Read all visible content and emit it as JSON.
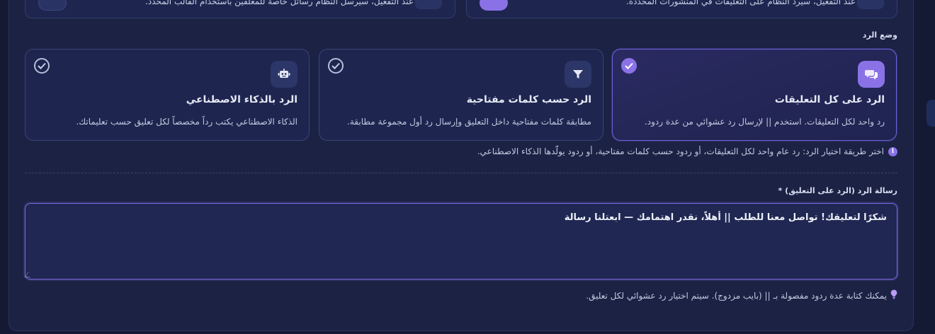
{
  "top_cards": [
    {
      "text": "عند التفعيل، سيرد النظام على التعليقات في المنشورات المحددة.",
      "side": "right"
    },
    {
      "text": "عند التفعيل، سيرسل النظام رسائل خاصة للمعلقين باستخدام القالب المحدد.",
      "side": "left"
    }
  ],
  "reply_mode": {
    "label": "وضع الرد",
    "options": [
      {
        "id": "all",
        "title": "الرد على كل التعليقات",
        "desc": "رد واحد لكل التعليقات. استخدم || لإرسال رد عشوائي من عدة ردود.",
        "icon": "comments-icon",
        "selected": true
      },
      {
        "id": "keywords",
        "title": "الرد حسب كلمات مفتاحية",
        "desc": "مطابقة كلمات مفتاحية داخل التعليق وإرسال رد أول مجموعة مطابقة.",
        "icon": "filter-icon",
        "selected": false
      },
      {
        "id": "ai",
        "title": "الرد بالذكاء الاصطناعي",
        "desc": "الذكاء الاصطناعي يكتب رداً مخصصاً لكل تعليق حسب تعليماتك.",
        "icon": "robot-icon",
        "selected": false
      }
    ],
    "info": "اختر طريقة اختيار الرد: رد عام واحد لكل التعليقات، أو ردود حسب كلمات مفتاحية، أو ردود يولّدها الذكاء الاصطناعي."
  },
  "reply_message": {
    "label": "رسالة الرد (الرد على التعليق) *",
    "value": "شكرًا لتعليقك! تواصل معنا للطلب || أهلاً، نقدر اهتمامك — ابعتلنا رسالة",
    "hint": "يمكنك كتابة عدة ردود مفصولة بـ || (بايب مزدوج). سيتم اختيار رد عشوائي لكل تعليق."
  },
  "colors": {
    "accent": "#8a72e6",
    "panel": "#1b2244",
    "card": "#1e2650"
  }
}
